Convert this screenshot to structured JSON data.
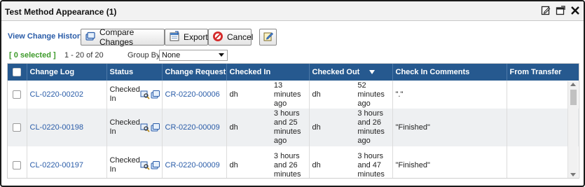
{
  "window": {
    "title": "Test Method Appearance (1)"
  },
  "title_icons": [
    "edit-icon",
    "popout-window-icon",
    "close-icon"
  ],
  "toolbar": {
    "view_change_history": "View Change History",
    "compare_changes": "Compare Changes",
    "export": "Export",
    "cancel": "Cancel"
  },
  "info": {
    "selected": "[ 0 selected ]",
    "range": "1 - 20 of 20",
    "group_by_label": "Group By",
    "group_by_value": "None"
  },
  "columns": [
    "Change Log",
    "Status",
    "Change Request",
    "Checked In",
    "Checked Out",
    "Check In Comments",
    "From Transfer"
  ],
  "sort": {
    "column": "Checked Out",
    "direction": "descending"
  },
  "rows": [
    {
      "change_log": "CL-0220-00202",
      "status": "Checked In",
      "change_request": "CR-0220-00006",
      "checked_in_by": "dh",
      "checked_in_time": "13 minutes ago",
      "checked_out_by": "dh",
      "checked_out_time": "52 minutes ago",
      "comments": "\".\"",
      "from_transfer": ""
    },
    {
      "change_log": "CL-0220-00198",
      "status": "Checked In",
      "change_request": "CR-0220-00009",
      "checked_in_by": "dh",
      "checked_in_time": "3 hours and 25 minutes ago",
      "checked_out_by": "dh",
      "checked_out_time": "3 hours and 26 minutes ago",
      "comments": "\"Finished\"",
      "from_transfer": ""
    },
    {
      "change_log": "CL-0220-00197",
      "status": "Checked In",
      "change_request": "CR-0220-00009",
      "checked_in_by": "dh",
      "checked_in_time": "3 hours and 26 minutes",
      "checked_out_by": "dh",
      "checked_out_time": "3 hours and 47 minutes",
      "comments": "\"Finished\"",
      "from_transfer": ""
    }
  ],
  "colors": {
    "header_bg": "#26598f",
    "link": "#2a5ca8",
    "selected_text": "#3d9a2a",
    "alt_row": "#eef0f2"
  }
}
